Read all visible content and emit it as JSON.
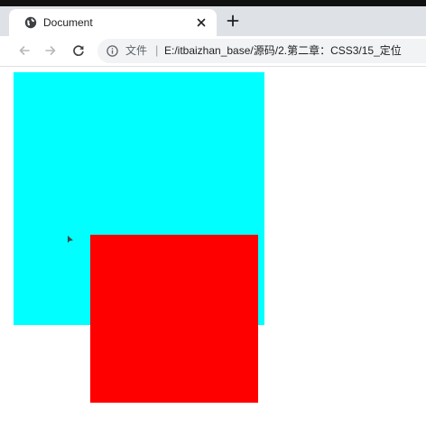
{
  "browser": {
    "tab": {
      "title": "Document",
      "icon": "globe-icon"
    },
    "new_tab_icon": "plus-icon",
    "close_tab_icon": "close-icon",
    "nav": {
      "back_icon": "back-arrow-icon",
      "forward_icon": "forward-arrow-icon",
      "reload_icon": "reload-icon"
    },
    "address": {
      "info_icon": "info-icon",
      "site_label": "文件",
      "separator": "|",
      "url": "E:/itbaizhan_base/源码/2.第二章：CSS3/15_定位"
    }
  },
  "page": {
    "boxes": [
      {
        "name": "cyan-box",
        "color": "#00ffff"
      },
      {
        "name": "red-box",
        "color": "#ff0000"
      }
    ]
  },
  "colors": {
    "tabbar": "#dee1e6",
    "omnibox": "#f1f3f4",
    "top_strip": "#111111"
  }
}
